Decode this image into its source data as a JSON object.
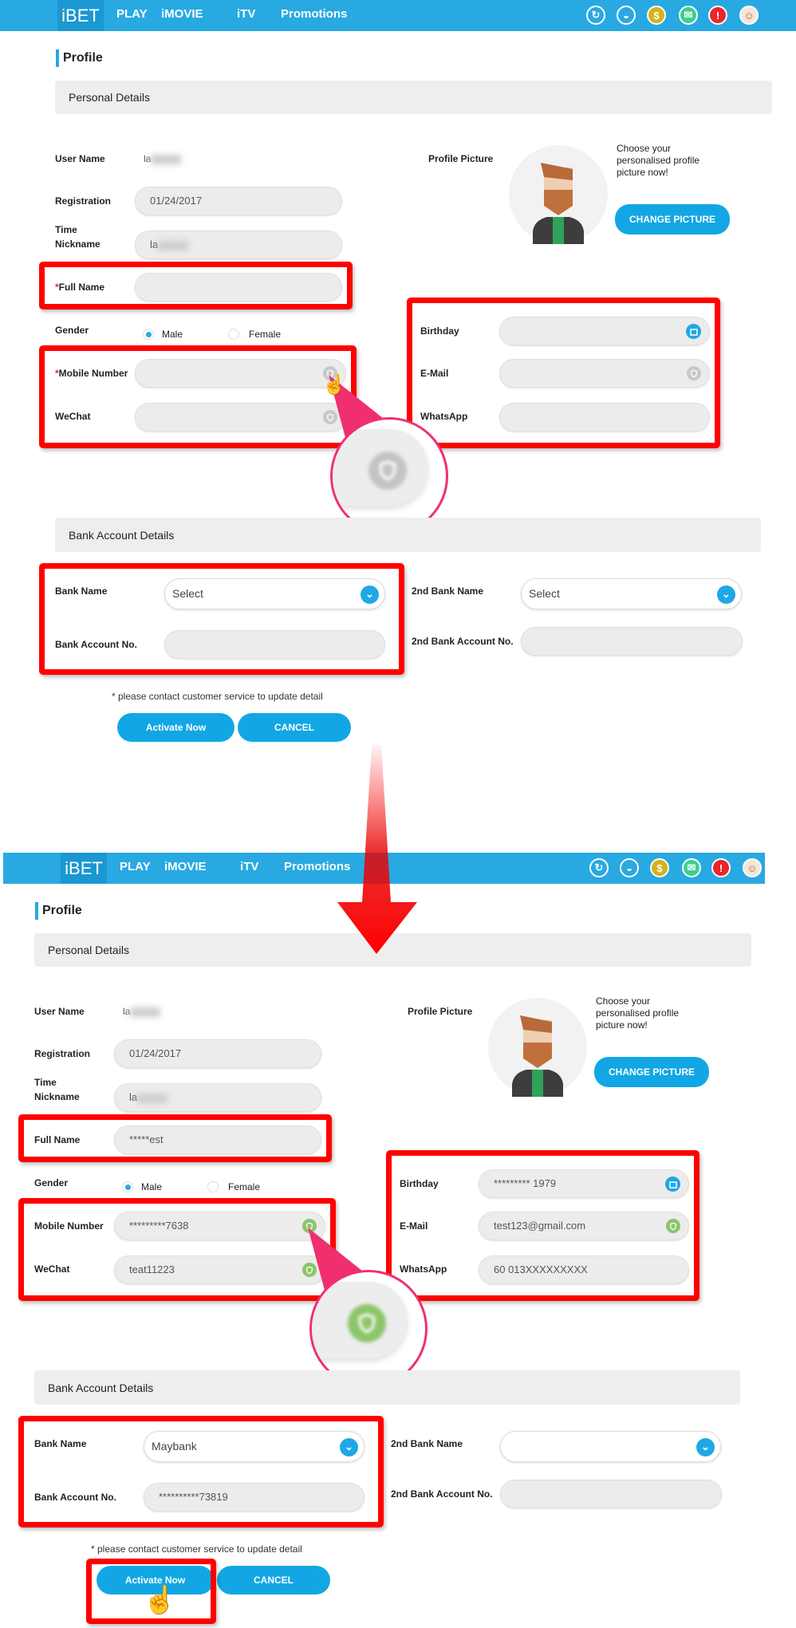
{
  "nav": {
    "brand": "iBET",
    "items": [
      "PLAY",
      "iMOVIE",
      "iTV",
      "Promotions"
    ],
    "icons": [
      "refresh-icon",
      "chat-icon",
      "coin-icon",
      "mail-icon",
      "alert-icon",
      "user-avatar-icon"
    ],
    "coin_glyph": "$",
    "alert_glyph": "!",
    "color": "#29a9e1"
  },
  "labels": {
    "profile": "Profile",
    "personal_details": "Personal Details",
    "user_name": "User Name",
    "registration_time_1": "Registration",
    "registration_time_2": "Time",
    "nickname": "Nickname",
    "full_name": "Full Name",
    "gender": "Gender",
    "male": "Male",
    "female": "Female",
    "mobile_number": "Mobile Number",
    "wechat": "WeChat",
    "profile_picture": "Profile Picture",
    "picture_note": "Choose your personalised profile picture now!",
    "change_picture": "CHANGE PICTURE",
    "birthday": "Birthday",
    "email": "E-Mail",
    "whatsapp": "WhatsApp",
    "bank_account_details": "Bank Account Details",
    "bank_name": "Bank Name",
    "bank_account_no": "Bank Account No.",
    "second_bank_name": "2nd Bank Name",
    "second_bank_account_no": "2nd Bank Account No.",
    "note": "* please contact customer service to update detail",
    "activate_now": "Activate Now",
    "cancel": "CANCEL"
  },
  "before": {
    "user_name": "la",
    "registration_time": "01/24/2017",
    "nickname": "la",
    "full_name_required": "*",
    "full_name": "",
    "gender": "Male",
    "mobile_required": "*",
    "mobile_number": "",
    "wechat": "",
    "birthday": "",
    "email": "",
    "whatsapp": "",
    "bank_name": "Select",
    "bank_account_no": "",
    "second_bank_name": "Select",
    "second_bank_account_no": "",
    "verified": false
  },
  "after": {
    "user_name": "la",
    "registration_time": "01/24/2017",
    "nickname": "la",
    "full_name_required": "",
    "full_name": "*****est",
    "gender": "Male",
    "mobile_required": "",
    "mobile_number": "*********7638",
    "wechat": "teat11223",
    "birthday": "********* 1979",
    "email": "test123@gmail.com",
    "whatsapp": "60 013XXXXXXXXX",
    "bank_name": "Maybank",
    "bank_account_no": "**********73819",
    "second_bank_name": "",
    "second_bank_account_no": "",
    "verified": true
  },
  "colors": {
    "accent": "#29a9e1",
    "highlight": "#ff0000",
    "magnifier": "#f0306e",
    "verified": "#8cc56a"
  }
}
